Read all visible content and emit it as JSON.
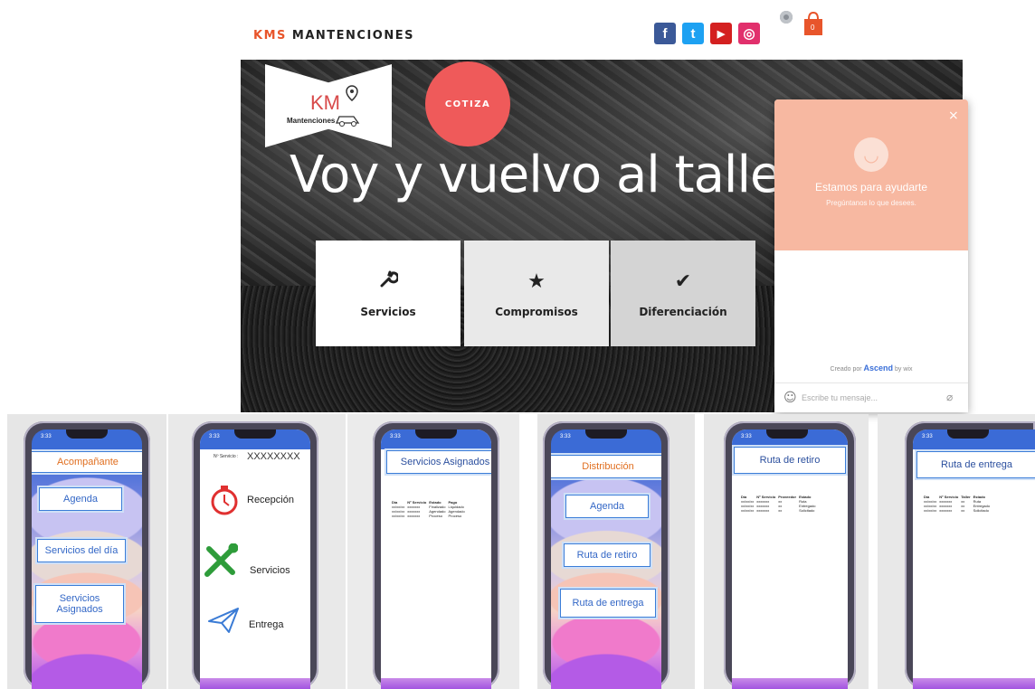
{
  "header": {
    "brand_prefix": "KMS",
    "brand_rest": " MANTENCIONES",
    "social": [
      {
        "name": "facebook",
        "glyph": "f",
        "color": "#3b5998"
      },
      {
        "name": "twitter",
        "glyph": "t",
        "color": "#1da1f2"
      },
      {
        "name": "youtube",
        "glyph": "▶",
        "color": "#d42020"
      },
      {
        "name": "instagram",
        "glyph": "◎",
        "color": "#e1306c"
      }
    ],
    "cart_count": "0"
  },
  "hero": {
    "logo_text": "KM",
    "logo_sub": "Mantenciones",
    "cotiza": "COTIZA",
    "slogan": "Voy y vuelvo al taller",
    "cards": [
      {
        "label": "Servicios",
        "icon": "wrench-icon"
      },
      {
        "label": "Compromisos",
        "icon": "star-icon"
      },
      {
        "label": "Diferenciación",
        "icon": "check-icon"
      }
    ]
  },
  "chat": {
    "close": "×",
    "title": "Estamos para ayudarte",
    "subtitle": "Pregúntanos lo que desees.",
    "created_by": "Creado por",
    "brand": "Ascend",
    "brand_suffix": "by wix",
    "placeholder": "Escribe tu mensaje..."
  },
  "phones": {
    "status_time": "3:33",
    "p1": {
      "title": "Acompañante",
      "buttons": [
        "Agenda",
        "Servicios del día",
        "Servicios Asignados"
      ]
    },
    "p2": {
      "service_label": "Nº Servicio :",
      "service_value": "XXXXXXXX",
      "items": [
        "Recepción",
        "Servicios",
        "Entrega"
      ]
    },
    "p3": {
      "title": "Servicios Asignados",
      "headers": [
        "Día",
        "Nº Servicio",
        "Estado",
        "Pago"
      ],
      "rows": [
        [
          "xx/xx/xx",
          "xxxxxxx",
          "Finalizado",
          "Liquidado"
        ],
        [
          "xx/xx/xx",
          "xxxxxxx",
          "Agendado",
          "Agendado"
        ],
        [
          "xx/xx/xx",
          "xxxxxxx",
          "Proceso",
          "Proceso"
        ]
      ]
    },
    "p4": {
      "title": "Distribución",
      "buttons": [
        "Agenda",
        "Ruta de retiro",
        "Ruta de entrega"
      ]
    },
    "p5": {
      "title": "Ruta de retiro",
      "headers": [
        "Día",
        "Nº Servicio",
        "Proveedor",
        "Estado"
      ],
      "rows": [
        [
          "xx/xx/xx",
          "xxxxxxx",
          "xx",
          "Ruta"
        ],
        [
          "xx/xx/xx",
          "xxxxxxx",
          "xx",
          "Entregado"
        ],
        [
          "xx/xx/xx",
          "xxxxxxx",
          "xx",
          "Solicitado"
        ]
      ]
    },
    "p6": {
      "title": "Ruta de entrega",
      "headers": [
        "Día",
        "Nº Servicio",
        "Taller",
        "Estado"
      ],
      "rows": [
        [
          "xx/xx/xx",
          "xxxxxxx",
          "xx",
          "Ruta"
        ],
        [
          "xx/xx/xx",
          "xxxxxxx",
          "xx",
          "Entregado"
        ],
        [
          "xx/xx/xx",
          "xxxxxxx",
          "xx",
          "Solicitado"
        ]
      ]
    }
  }
}
